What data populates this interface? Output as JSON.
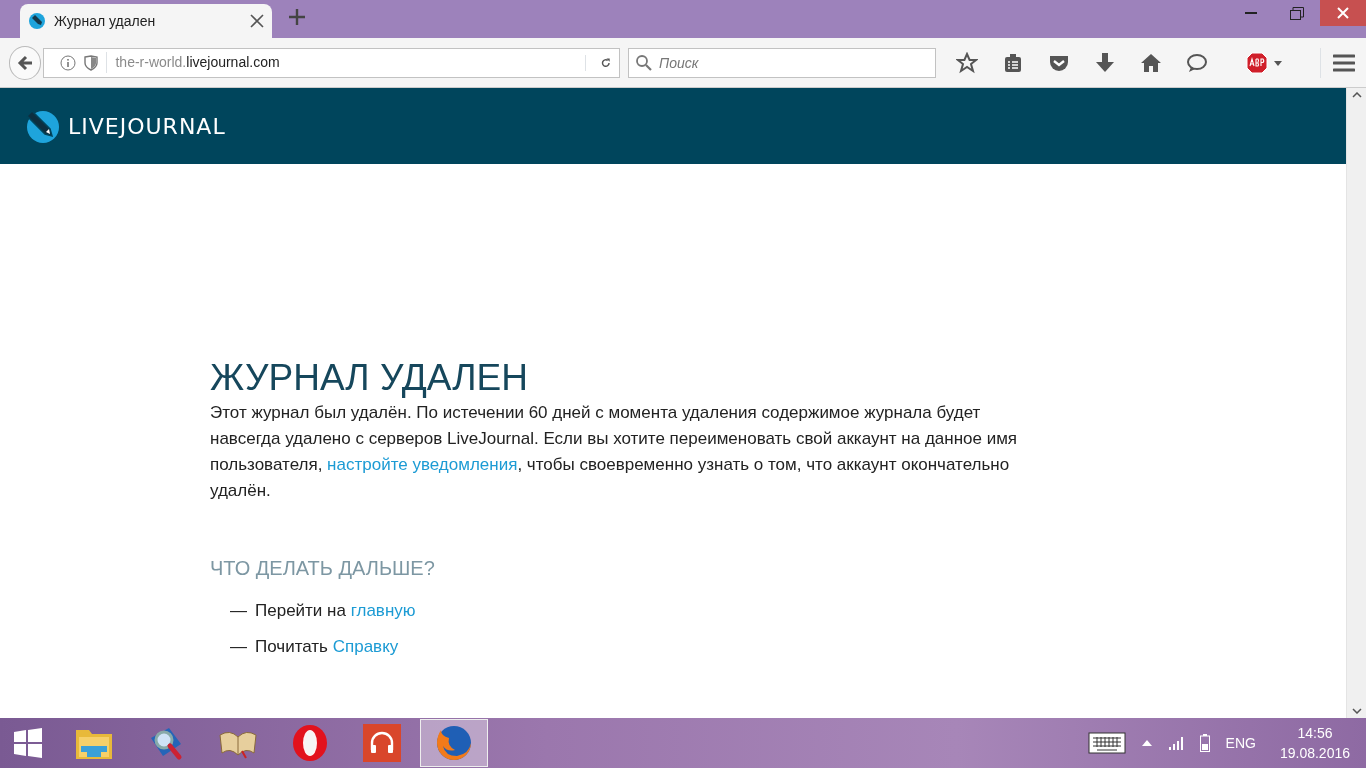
{
  "browser": {
    "tab": {
      "title": "Журнал удален"
    },
    "url": {
      "subdomain": "the-r-world.",
      "domain": "livejournal.com"
    },
    "search": {
      "placeholder": "Поиск"
    }
  },
  "site": {
    "logo_text": "LIVEJOURNAL"
  },
  "page": {
    "title": "ЖУРНАЛ УДАЛЕН",
    "message": {
      "before": "Этот журнал был удалён. По истечении 60 дней с момента удаления содержимое журнала будет навсегда удалено с серверов LiveJournal. Если вы хотите переименовать свой аккаунт на данное имя пользователя, ",
      "link": "настройте уведомления",
      "after": ", чтобы своевременно узнать о том, что аккаунт окончательно удалён."
    },
    "next_heading": "ЧТО ДЕЛАТЬ ДАЛЬШЕ?",
    "next_steps": [
      {
        "dash": "—",
        "text": "Перейти на ",
        "link": "главную"
      },
      {
        "dash": "—",
        "text": "Почитать ",
        "link": "Справку"
      }
    ]
  },
  "taskbar": {
    "apps": [
      {
        "kind": "explorer",
        "selected": false
      },
      {
        "kind": "magnifier",
        "selected": false
      },
      {
        "kind": "book",
        "selected": false
      },
      {
        "kind": "opera",
        "selected": false
      },
      {
        "kind": "music",
        "selected": false
      },
      {
        "kind": "firefox",
        "selected": true
      }
    ],
    "language": "ENG",
    "time": "14:56",
    "date": "19.08.2016"
  }
}
